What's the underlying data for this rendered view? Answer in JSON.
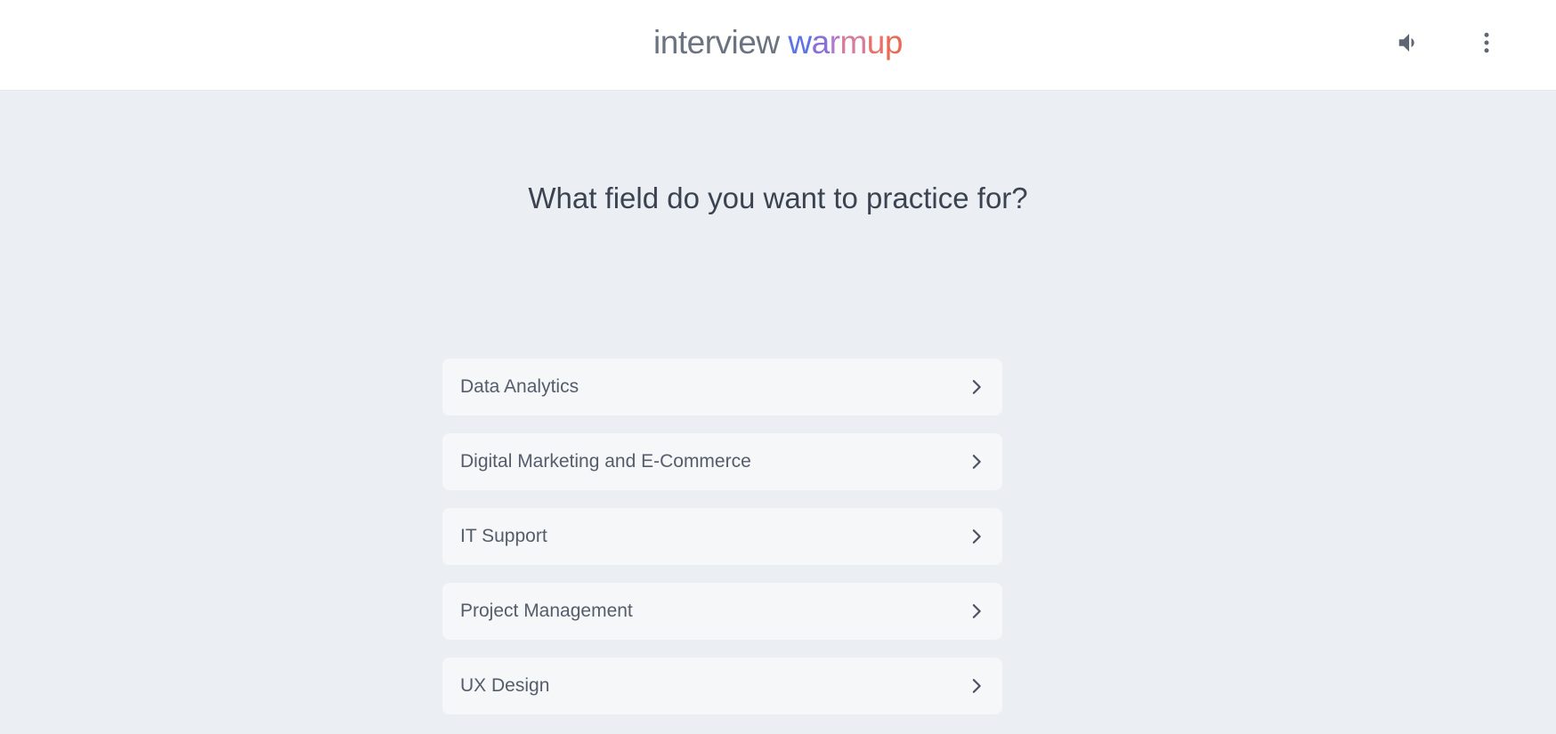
{
  "header": {
    "logo_prefix": "interview ",
    "logo_letters": [
      "w",
      "a",
      "r",
      "m",
      "u",
      "p"
    ],
    "sound_icon": "volume-up-icon",
    "menu_icon": "more-vert-icon"
  },
  "main": {
    "title": "What field do you want to practice for?",
    "options": [
      {
        "label": "Data Analytics"
      },
      {
        "label": "Digital Marketing and E-Commerce"
      },
      {
        "label": "IT Support"
      },
      {
        "label": "Project Management"
      },
      {
        "label": "UX Design"
      }
    ]
  },
  "colors": {
    "background": "#ebeff4",
    "header_bg": "#ffffff",
    "card_bg": "#f5f7f9",
    "text_dark": "#3c4350",
    "text_label": "#555d6b"
  }
}
